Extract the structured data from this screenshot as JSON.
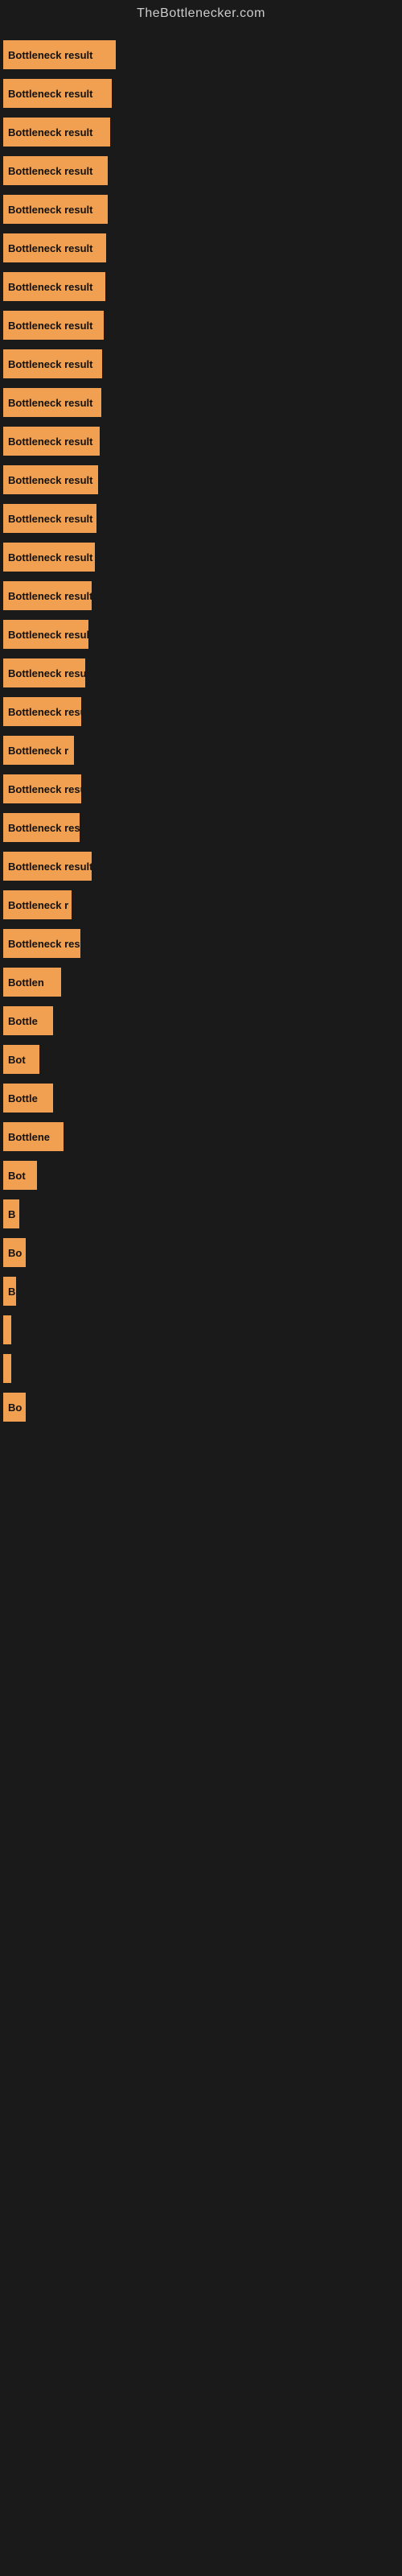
{
  "site": {
    "title": "TheBottlenecker.com"
  },
  "bars": [
    {
      "label": "Bottleneck result",
      "width": 140
    },
    {
      "label": "Bottleneck result",
      "width": 135
    },
    {
      "label": "Bottleneck result",
      "width": 133
    },
    {
      "label": "Bottleneck result",
      "width": 130
    },
    {
      "label": "Bottleneck result",
      "width": 130
    },
    {
      "label": "Bottleneck result",
      "width": 128
    },
    {
      "label": "Bottleneck result",
      "width": 127
    },
    {
      "label": "Bottleneck result",
      "width": 125
    },
    {
      "label": "Bottleneck result",
      "width": 123
    },
    {
      "label": "Bottleneck result",
      "width": 122
    },
    {
      "label": "Bottleneck result",
      "width": 120
    },
    {
      "label": "Bottleneck result",
      "width": 118
    },
    {
      "label": "Bottleneck result",
      "width": 116
    },
    {
      "label": "Bottleneck result",
      "width": 114
    },
    {
      "label": "Bottleneck result",
      "width": 110
    },
    {
      "label": "Bottleneck result",
      "width": 106
    },
    {
      "label": "Bottleneck result",
      "width": 102
    },
    {
      "label": "Bottleneck resu",
      "width": 97
    },
    {
      "label": "Bottleneck r",
      "width": 88
    },
    {
      "label": "Bottleneck resu",
      "width": 97
    },
    {
      "label": "Bottleneck res",
      "width": 95
    },
    {
      "label": "Bottleneck result",
      "width": 110
    },
    {
      "label": "Bottleneck r",
      "width": 85
    },
    {
      "label": "Bottleneck resu",
      "width": 96
    },
    {
      "label": "Bottlen",
      "width": 72
    },
    {
      "label": "Bottle",
      "width": 62
    },
    {
      "label": "Bot",
      "width": 45
    },
    {
      "label": "Bottle",
      "width": 62
    },
    {
      "label": "Bottlene",
      "width": 75
    },
    {
      "label": "Bot",
      "width": 42
    },
    {
      "label": "B",
      "width": 20
    },
    {
      "label": "Bo",
      "width": 28
    },
    {
      "label": "B",
      "width": 16
    },
    {
      "label": "",
      "width": 8
    },
    {
      "label": "",
      "width": 4
    },
    {
      "label": "Bo",
      "width": 28
    }
  ]
}
